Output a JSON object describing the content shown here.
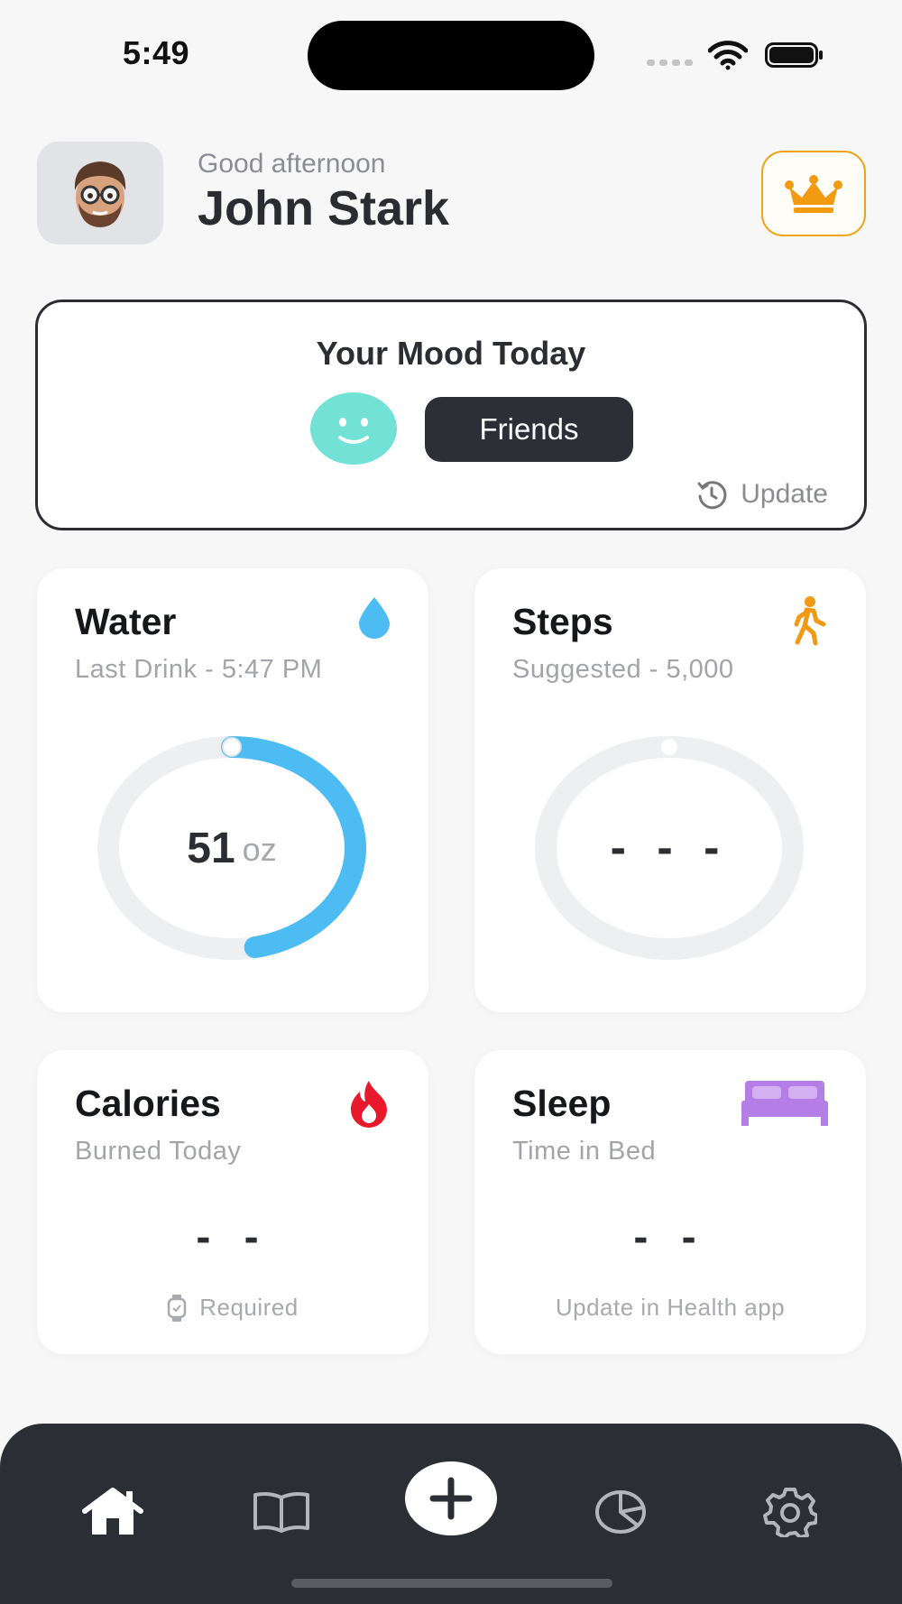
{
  "status_bar": {
    "time": "5:49"
  },
  "header": {
    "greeting": "Good afternoon",
    "user_name": "John Stark",
    "avatar_icon": "memoji-avatar",
    "premium_icon": "crown-icon"
  },
  "mood": {
    "title": "Your Mood Today",
    "face_icon": "smiley-face-icon",
    "tag": "Friends",
    "update_label": "Update"
  },
  "water": {
    "title": "Water",
    "subtitle": "Last Drink - 5:47 PM",
    "value": "51",
    "unit": "oz",
    "progress_fraction": 0.47,
    "icon": "water-drop-icon",
    "accent": "#4cbcf3"
  },
  "steps": {
    "title": "Steps",
    "subtitle": "Suggested - 5,000",
    "value": "- - -",
    "icon": "walking-icon",
    "accent": "#f09a14"
  },
  "calories": {
    "title": "Calories",
    "subtitle": "Burned Today",
    "value": "- -",
    "footer": "Required",
    "icon": "flame-icon",
    "accent": "#e8192c"
  },
  "sleep": {
    "title": "Sleep",
    "subtitle": "Time in Bed",
    "value": "- -",
    "footer": "Update in Health app",
    "icon": "bed-icon",
    "accent": "#b57ee6"
  },
  "tab_bar": {
    "tabs": [
      "home-icon",
      "journal-book-icon",
      "add-icon",
      "stats-pie-icon",
      "settings-gear-icon"
    ],
    "active": "home-icon"
  }
}
